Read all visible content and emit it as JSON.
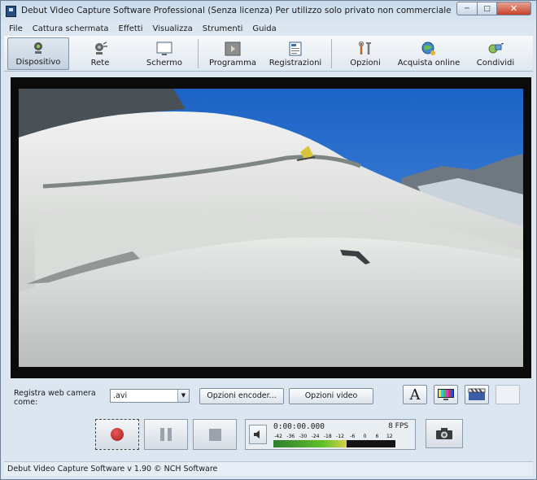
{
  "window": {
    "title": "Debut Video Capture Software Professional (Senza licenza) Per utilizzo solo privato non commerciale"
  },
  "menu": [
    {
      "label": "File"
    },
    {
      "label": "Cattura schermata"
    },
    {
      "label": "Effetti"
    },
    {
      "label": "Visualizza"
    },
    {
      "label": "Strumenti"
    },
    {
      "label": "Guida"
    }
  ],
  "toolbar": {
    "dispositivo": "Dispositivo",
    "rete": "Rete",
    "schermo": "Schermo",
    "programma": "Programma",
    "registrazioni": "Registrazioni",
    "opzioni": "Opzioni",
    "acquista": "Acquista online",
    "condividi": "Condividi"
  },
  "record": {
    "label": "Registra web camera come:",
    "format": ".avi",
    "encoder_button": "Opzioni encoder...",
    "video_button": "Opzioni video"
  },
  "transport": {
    "time": "0:00:00.000",
    "fps": "8 FPS",
    "meter_ticks": [
      "-42",
      "-36",
      "-30",
      "-24",
      "-18",
      "-12",
      "-6",
      "0",
      "6",
      "12"
    ]
  },
  "status": {
    "text": "Debut Video Capture Software v 1.90 © NCH Software"
  },
  "colors": {
    "accent": "#2a4f7e",
    "record_red": "#c62828",
    "window_bg": "#dbe6f0"
  }
}
